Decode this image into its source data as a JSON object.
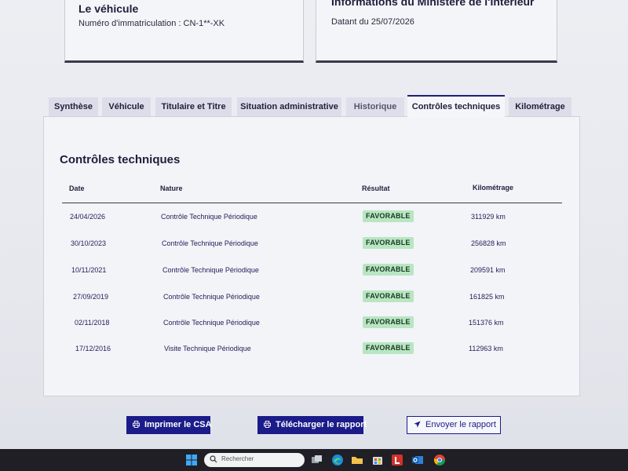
{
  "vehicle_card": {
    "title": "Le véhicule",
    "registration": "Numéro d'immatriculation : CN-1**-XK"
  },
  "ministry_card": {
    "title": "Informations du Ministère de l'Intérieur",
    "date_line": "Datant du 25/07/2026"
  },
  "tabs": [
    {
      "label": "Synthèse"
    },
    {
      "label": "Véhicule"
    },
    {
      "label": "Titulaire et Titre"
    },
    {
      "label": "Situation administrative"
    },
    {
      "label": "Historique"
    },
    {
      "label": "Contrôles techniques",
      "active": true
    },
    {
      "label": "Kilométrage"
    }
  ],
  "panel": {
    "title": "Contrôles techniques",
    "columns": {
      "date": "Date",
      "nature": "Nature",
      "result": "Résultat",
      "mileage": "Kilométrage"
    },
    "rows": [
      {
        "date": "24/04/2026",
        "nature": "Contrôle Technique Périodique",
        "result": "FAVORABLE",
        "mileage": "311929 km"
      },
      {
        "date": "30/10/2023",
        "nature": "Contrôle Technique Périodique",
        "result": "FAVORABLE",
        "mileage": "256828 km"
      },
      {
        "date": "10/11/2021",
        "nature": "Contrôle Technique Périodique",
        "result": "FAVORABLE",
        "mileage": "209591 km"
      },
      {
        "date": "27/09/2019",
        "nature": "Contrôle Technique Périodique",
        "result": "FAVORABLE",
        "mileage": "161825 km"
      },
      {
        "date": "02/11/2018",
        "nature": "Contrôle Technique Périodique",
        "result": "FAVORABLE",
        "mileage": "151376 km"
      },
      {
        "date": "17/12/2016",
        "nature": "Visite Technique Périodique",
        "result": "FAVORABLE",
        "mileage": "112963 km"
      }
    ]
  },
  "actions": {
    "print_label": "Imprimer le CSA",
    "download_label": "Télécharger le rapport",
    "send_label": "Envoyer le rapport"
  },
  "taskbar": {
    "search_placeholder": "Rechercher"
  },
  "colors": {
    "primary": "#1b1b8a",
    "badge_bg": "#b8e6c2",
    "badge_text": "#1a3a24",
    "taskbar": "#1f1f25"
  },
  "icons": [
    "printer-icon",
    "send-icon",
    "windows-start-icon",
    "search-icon",
    "task-view-icon",
    "edge-icon",
    "folder-icon",
    "store-icon",
    "app-l-icon",
    "outlook-icon",
    "chrome-icon"
  ]
}
